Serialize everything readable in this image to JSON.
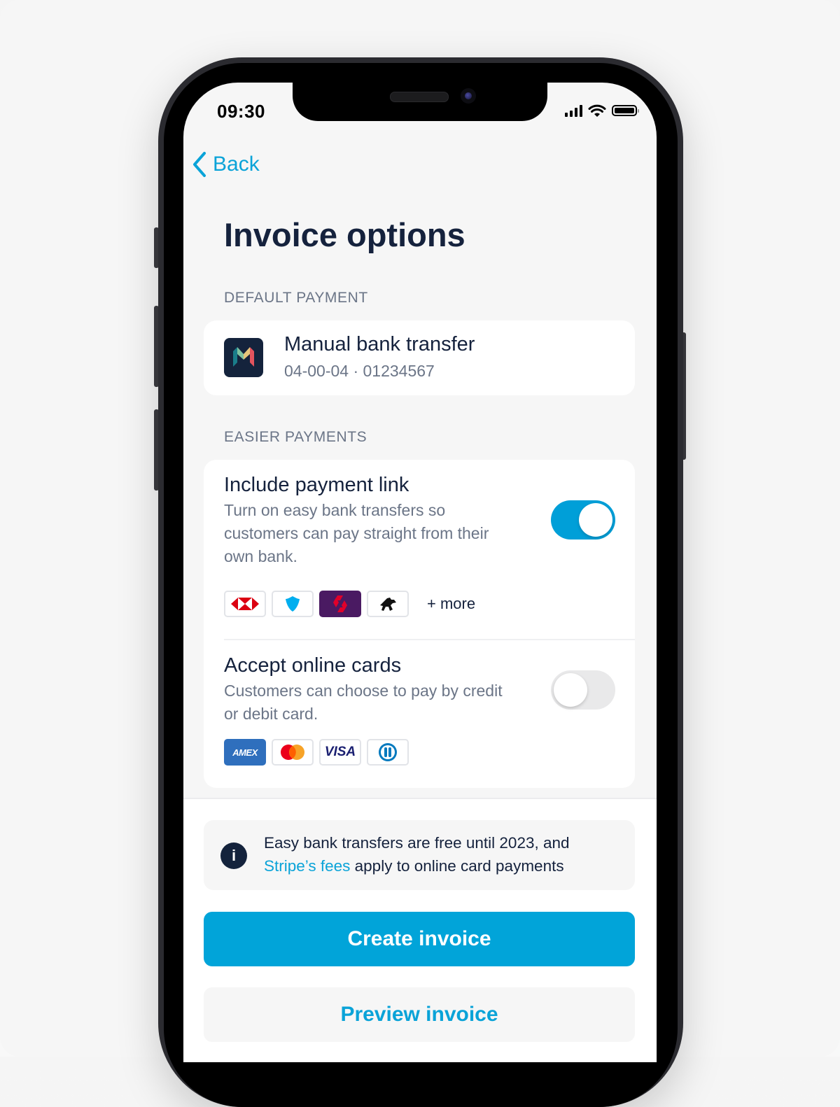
{
  "status_bar": {
    "time": "09:30"
  },
  "nav": {
    "back_label": "Back"
  },
  "page": {
    "title": "Invoice options"
  },
  "default_payment": {
    "section_label": "DEFAULT PAYMENT",
    "method_title": "Manual bank transfer",
    "account_details": "04-00-04 · 01234567",
    "bank_logo_letter": "M"
  },
  "easier_payments": {
    "section_label": "EASIER PAYMENTS",
    "options": [
      {
        "title": "Include payment link",
        "description_lines": [
          "Turn on easy bank transfers so",
          "customers can pay straight from their",
          "own bank."
        ],
        "enabled": true,
        "logos": [
          "hsbc-logo",
          "barclays-logo",
          "natwest-logo",
          "lloyds-logo"
        ],
        "more_label": "+ more"
      },
      {
        "title": "Accept online cards",
        "description_lines": [
          "Customers can choose to pay by credit",
          "or debit card."
        ],
        "enabled": false,
        "logos": [
          "amex-logo",
          "mastercard-logo",
          "visa-logo",
          "diners-club-logo"
        ],
        "amex_text": "AMEX",
        "visa_text": "VISA"
      }
    ]
  },
  "info": {
    "text_line1": "Easy bank transfers are free until 2023, and",
    "link_text": "Stripe’s fees",
    "text_line2_rest": " apply to online card payments"
  },
  "actions": {
    "create_label": "Create invoice",
    "preview_label": "Preview invoice"
  },
  "colors": {
    "accent": "#01a4d9",
    "navy": "#15223d",
    "muted": "#6b7587"
  }
}
